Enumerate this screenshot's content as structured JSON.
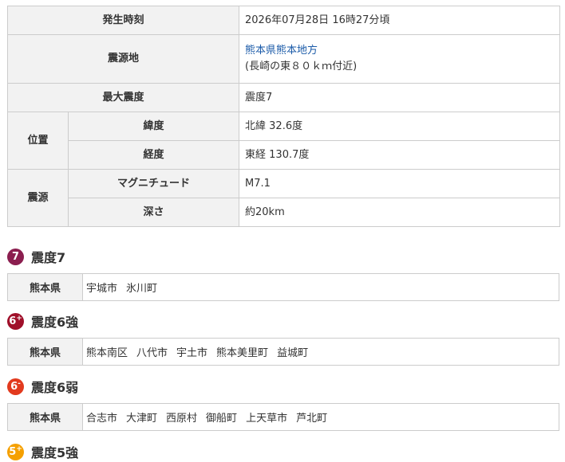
{
  "quake_info": {
    "occurrence_label": "発生時刻",
    "occurrence_value": "2026年07月28日 16時27分頃",
    "epicenter_label": "震源地",
    "epicenter_link": "熊本県熊本地方",
    "epicenter_note": "(長崎の東８０ｋｍ付近)",
    "max_intensity_label": "最大震度",
    "max_intensity_value": "震度7",
    "position_label": "位置",
    "latitude_label": "緯度",
    "latitude_value": "北緯 32.6度",
    "longitude_label": "経度",
    "longitude_value": "東経 130.7度",
    "source_label": "震源",
    "magnitude_label": "マグニチュード",
    "magnitude_value": "M7.1",
    "depth_label": "深さ",
    "depth_value": "約20km"
  },
  "intensity_sections": [
    {
      "badge": "7",
      "badge_suffix": "",
      "badge_color": "#8b1e4f",
      "title": "震度7",
      "prefecture": "熊本県",
      "cities": [
        "宇城市",
        "氷川町"
      ]
    },
    {
      "badge": "6",
      "badge_suffix": "+",
      "badge_color": "#a0102a",
      "title": "震度6強",
      "prefecture": "熊本県",
      "cities": [
        "熊本南区",
        "八代市",
        "宇土市",
        "熊本美里町",
        "益城町"
      ]
    },
    {
      "badge": "6",
      "badge_suffix": "-",
      "badge_color": "#e23a1e",
      "title": "震度6弱",
      "prefecture": "熊本県",
      "cities": [
        "合志市",
        "大津町",
        "西原村",
        "御船町",
        "上天草市",
        "芦北町"
      ]
    },
    {
      "badge": "5",
      "badge_suffix": "+",
      "badge_color": "#f5a000",
      "title": "震度5強"
    }
  ]
}
